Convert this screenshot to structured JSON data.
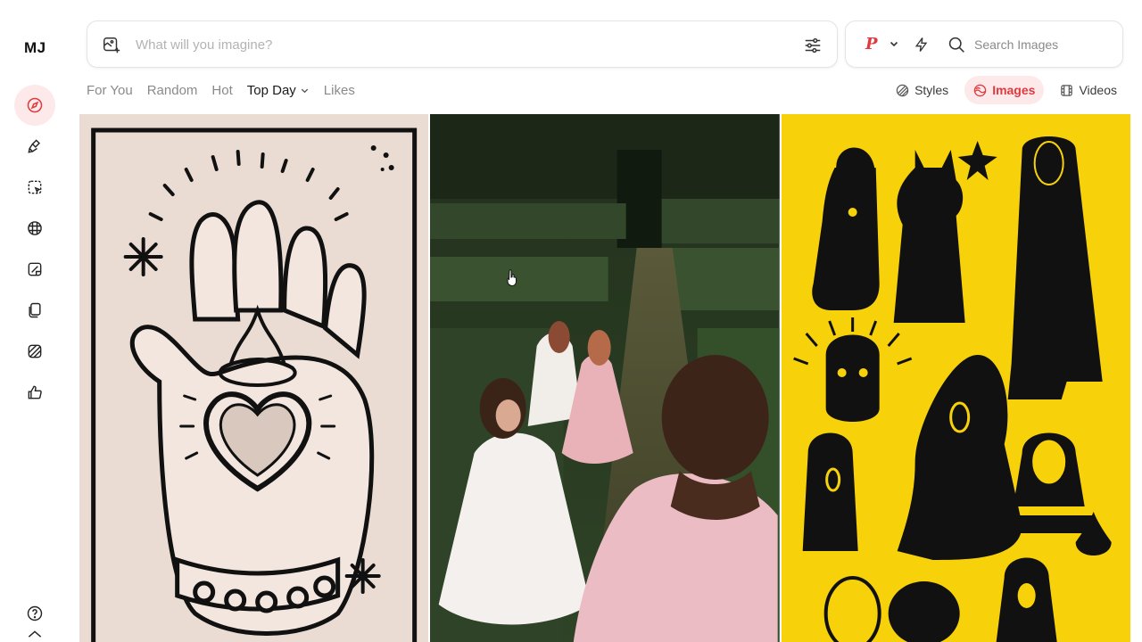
{
  "app": {
    "logo": "MJ"
  },
  "sidebar": {
    "items": [
      {
        "name": "explore",
        "icon": "compass-icon",
        "active": true
      },
      {
        "name": "create",
        "icon": "paintbrush-icon",
        "active": false
      },
      {
        "name": "edit",
        "icon": "edit-selection-icon",
        "active": false
      },
      {
        "name": "personalize",
        "icon": "grid-globe-icon",
        "active": false
      },
      {
        "name": "moodboards",
        "icon": "image-edit-icon",
        "active": false
      },
      {
        "name": "organize",
        "icon": "copy-icon",
        "active": false
      },
      {
        "name": "style-creator",
        "icon": "striped-square-icon",
        "active": false
      },
      {
        "name": "likes",
        "icon": "thumbs-up-icon",
        "active": false
      }
    ],
    "bottom": [
      {
        "name": "help",
        "icon": "help-icon"
      }
    ]
  },
  "prompt": {
    "placeholder": "What will you imagine?",
    "value": ""
  },
  "search": {
    "personalization_badge": "P",
    "placeholder": "Search Images",
    "value": ""
  },
  "tabs": [
    {
      "label": "For You",
      "active": false
    },
    {
      "label": "Random",
      "active": false
    },
    {
      "label": "Hot",
      "active": false
    },
    {
      "label": "Top Day",
      "active": true,
      "has_dropdown": true
    },
    {
      "label": "Likes",
      "active": false
    }
  ],
  "view_toggle": [
    {
      "label": "Styles",
      "active": false,
      "icon": "styles-icon"
    },
    {
      "label": "Images",
      "active": true,
      "icon": "images-icon"
    },
    {
      "label": "Videos",
      "active": false,
      "icon": "videos-icon"
    }
  ],
  "gallery": [
    {
      "subject": "engraved hand with sacred heart"
    },
    {
      "subject": "girls in dresses running through hedge maze"
    },
    {
      "subject": "black figures on yellow background"
    }
  ],
  "colors": {
    "accent": "#e0393e",
    "accent_bg": "#fde9ea",
    "yellow": "#f7d10a"
  }
}
